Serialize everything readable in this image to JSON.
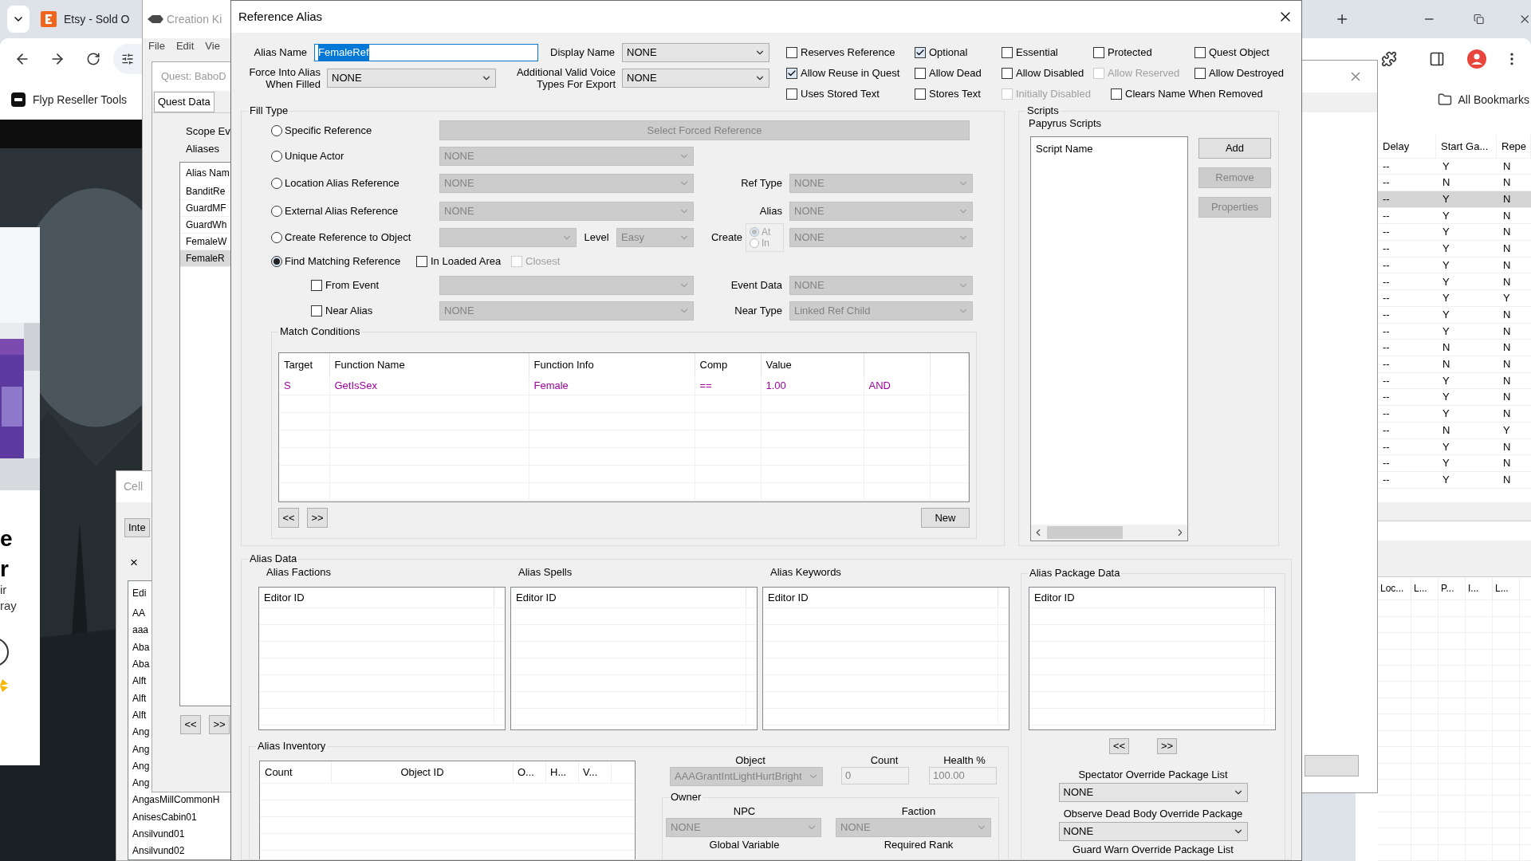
{
  "browser": {
    "tab_title": "Etsy - Sold O",
    "bookmarks": [
      {
        "label": "Flyp Reseller Tools"
      }
    ],
    "all_bookmarks": "All Bookmarks",
    "ad_texts": [
      "e",
      "r",
      "ir",
      "ray"
    ]
  },
  "creation_kit": {
    "title": "Creation Ki",
    "menu": [
      "File",
      "Edit",
      "Vie"
    ],
    "quest": {
      "title": "Quest: BaboD",
      "tabs": [
        {
          "label": "Quest Data",
          "selected": true
        }
      ],
      "scope": "Scope Ev",
      "aliases_label": "Aliases",
      "list_header": "Alias Nam",
      "aliases": [
        {
          "name": "BanditRe",
          "selected": false
        },
        {
          "name": "GuardMF",
          "selected": false
        },
        {
          "name": "GuardWh",
          "selected": false
        },
        {
          "name": "FemaleW",
          "selected": false
        },
        {
          "name": "FemaleR",
          "selected": true
        }
      ],
      "nav": [
        "<<",
        ">>"
      ]
    }
  },
  "cell_window": {
    "title": "Cell",
    "tab": "Inte",
    "close": "×",
    "header": "Edi",
    "rows": [
      "AA",
      "aaa",
      "Aba",
      "Aba",
      "Alft",
      "Alft",
      "Alft",
      "Ang",
      "Ang",
      "Ang",
      "Ang",
      "AngasMillCommonH",
      "AnisesCabin01",
      "Ansilvund01",
      "Ansilvund02"
    ]
  },
  "background_table": {
    "columns": [
      "Delay",
      "Start Ga...",
      "Repe"
    ],
    "rows": [
      {
        "delay": "--",
        "start": "Y",
        "repeat": "N",
        "selected": false
      },
      {
        "delay": "--",
        "start": "N",
        "repeat": "N",
        "selected": false
      },
      {
        "delay": "--",
        "start": "Y",
        "repeat": "N",
        "selected": true
      },
      {
        "delay": "--",
        "start": "Y",
        "repeat": "N",
        "selected": false
      },
      {
        "delay": "--",
        "start": "Y",
        "repeat": "N",
        "selected": false
      },
      {
        "delay": "--",
        "start": "Y",
        "repeat": "N",
        "selected": false
      },
      {
        "delay": "--",
        "start": "Y",
        "repeat": "N",
        "selected": false
      },
      {
        "delay": "--",
        "start": "Y",
        "repeat": "N",
        "selected": false
      },
      {
        "delay": "--",
        "start": "Y",
        "repeat": "Y",
        "selected": false
      },
      {
        "delay": "--",
        "start": "Y",
        "repeat": "N",
        "selected": false
      },
      {
        "delay": "--",
        "start": "Y",
        "repeat": "N",
        "selected": false
      },
      {
        "delay": "--",
        "start": "N",
        "repeat": "N",
        "selected": false
      },
      {
        "delay": "--",
        "start": "N",
        "repeat": "N",
        "selected": false
      },
      {
        "delay": "--",
        "start": "Y",
        "repeat": "N",
        "selected": false
      },
      {
        "delay": "--",
        "start": "Y",
        "repeat": "N",
        "selected": false
      },
      {
        "delay": "--",
        "start": "Y",
        "repeat": "N",
        "selected": false
      },
      {
        "delay": "--",
        "start": "N",
        "repeat": "Y",
        "selected": false
      },
      {
        "delay": "--",
        "start": "Y",
        "repeat": "N",
        "selected": false
      },
      {
        "delay": "--",
        "start": "Y",
        "repeat": "N",
        "selected": false
      },
      {
        "delay": "--",
        "start": "Y",
        "repeat": "N",
        "selected": false
      }
    ],
    "lower_columns": [
      "Loc...",
      "L...",
      "P...",
      "I...",
      "L..."
    ]
  },
  "dialog": {
    "title": "Reference Alias",
    "alias_name": {
      "label": "Alias Name",
      "value": "FemaleRef",
      "selected": true
    },
    "display_name": {
      "label": "Display Name",
      "value": "NONE",
      "disabled": false
    },
    "force_into_alias": {
      "label": "Force Into Alias When Filled",
      "value": "NONE",
      "disabled": false
    },
    "voice_types": {
      "label": "Additional Valid Voice Types For Export",
      "value": "NONE",
      "disabled": false
    },
    "flags": [
      {
        "label": "Reserves Reference",
        "checked": false,
        "disabled": false
      },
      {
        "label": "Optional",
        "checked": true,
        "disabled": false
      },
      {
        "label": "Essential",
        "checked": false,
        "disabled": false
      },
      {
        "label": "Protected",
        "checked": false,
        "disabled": false
      },
      {
        "label": "Quest Object",
        "checked": false,
        "disabled": false
      },
      {
        "label": "Allow Reuse in Quest",
        "checked": true,
        "disabled": false
      },
      {
        "label": "Allow Dead",
        "checked": false,
        "disabled": false
      },
      {
        "label": "Allow Disabled",
        "checked": false,
        "disabled": false
      },
      {
        "label": "Allow Reserved",
        "checked": false,
        "disabled": true
      },
      {
        "label": "Allow Destroyed",
        "checked": false,
        "disabled": false
      },
      {
        "label": "Uses Stored Text",
        "checked": false,
        "disabled": false
      },
      {
        "label": "Stores Text",
        "checked": false,
        "disabled": false
      },
      {
        "label": "Initially Disabled",
        "checked": false,
        "disabled": true
      },
      {
        "label": "Clears Name When Removed",
        "checked": false,
        "disabled": false
      }
    ],
    "fill_type": {
      "title": "Fill Type",
      "options": [
        {
          "label": "Specific Reference",
          "selected": false
        },
        {
          "label": "Unique Actor",
          "selected": false
        },
        {
          "label": "Location Alias Reference",
          "selected": false
        },
        {
          "label": "External Alias Reference",
          "selected": false
        },
        {
          "label": "Create Reference to Object",
          "selected": false
        },
        {
          "label": "Find Matching Reference",
          "selected": true
        }
      ],
      "forced_reference": {
        "label": "Select Forced Reference",
        "disabled": true
      },
      "unique_actor": {
        "value": "NONE",
        "disabled": true
      },
      "location_alias": {
        "value": "NONE",
        "disabled": true
      },
      "ref_type": {
        "label": "Ref Type",
        "value": "NONE",
        "disabled": true
      },
      "external_alias": {
        "value": "NONE",
        "disabled": true
      },
      "alias": {
        "label": "Alias",
        "value": "NONE",
        "disabled": true
      },
      "create_object": {
        "disabled": true
      },
      "level": {
        "label": "Level",
        "value": "Easy",
        "disabled": true
      },
      "create": {
        "label": "Create",
        "positions": [
          {
            "label": "At",
            "selected": true,
            "disabled": true
          },
          {
            "label": "In",
            "selected": false,
            "disabled": true
          }
        ],
        "value": "NONE",
        "disabled": true
      },
      "in_loaded_area": {
        "label": "In Loaded Area",
        "checked": false,
        "disabled": false
      },
      "closest": {
        "label": "Closest",
        "checked": false,
        "disabled": true
      },
      "from_event": {
        "label": "From Event",
        "checked": false,
        "disabled": false,
        "select": {
          "disabled": true
        }
      },
      "event_data": {
        "label": "Event Data",
        "value": "NONE",
        "disabled": true
      },
      "near_alias": {
        "label": "Near Alias",
        "checked": false,
        "disabled": false,
        "select": {
          "value": "NONE",
          "disabled": true
        }
      },
      "near_type": {
        "label": "Near Type",
        "value": "Linked Ref Child",
        "disabled": true
      },
      "match_conditions": {
        "title": "Match Conditions",
        "columns": [
          "Target",
          "Function Name",
          "Function Info",
          "Comp",
          "Value"
        ],
        "rows": [
          [
            "S",
            "GetIsSex",
            "Female",
            "==",
            "1.00",
            "AND"
          ]
        ],
        "nav": [
          "<<",
          ">>"
        ],
        "new_button": "New"
      }
    },
    "scripts": {
      "title": "Scripts",
      "subtitle": "Papyrus Scripts",
      "header": "Script Name",
      "buttons": [
        {
          "label": "Add",
          "disabled": false
        },
        {
          "label": "Remove",
          "disabled": true
        },
        {
          "label": "Properties",
          "disabled": true
        }
      ]
    },
    "alias_data": {
      "title": "Alias Data",
      "lists": [
        {
          "title": "Alias Factions",
          "header": "Editor ID"
        },
        {
          "title": "Alias Spells",
          "header": "Editor ID"
        },
        {
          "title": "Alias Keywords",
          "header": "Editor ID"
        }
      ],
      "package_data": {
        "title": "Alias Package Data",
        "header": "Editor ID",
        "nav": [
          "<<",
          ">>"
        ],
        "selects": [
          {
            "label": "Spectator Override Package List",
            "value": "NONE",
            "disabled": false
          },
          {
            "label": "Observe Dead Body Override Package",
            "value": "NONE",
            "disabled": false
          }
        ],
        "last_label": "Guard Warn Override Package List"
      },
      "inventory": {
        "title": "Alias Inventory",
        "columns": [
          "Count",
          "Object ID",
          "O...",
          "H...",
          "V..."
        ],
        "object": {
          "label": "Object",
          "value": "AAAGrantIntLightHurtBright",
          "disabled": true
        },
        "count": {
          "label": "Count",
          "value": "0",
          "disabled": true
        },
        "health": {
          "label": "Health %",
          "value": "100.00",
          "disabled": true
        },
        "owner": {
          "title": "Owner",
          "npc": {
            "label": "NPC",
            "value": "NONE",
            "disabled": true
          },
          "faction": {
            "label": "Faction",
            "value": "NONE",
            "disabled": true
          },
          "labels": [
            "Global Variable",
            "Required Rank"
          ]
        }
      }
    }
  }
}
